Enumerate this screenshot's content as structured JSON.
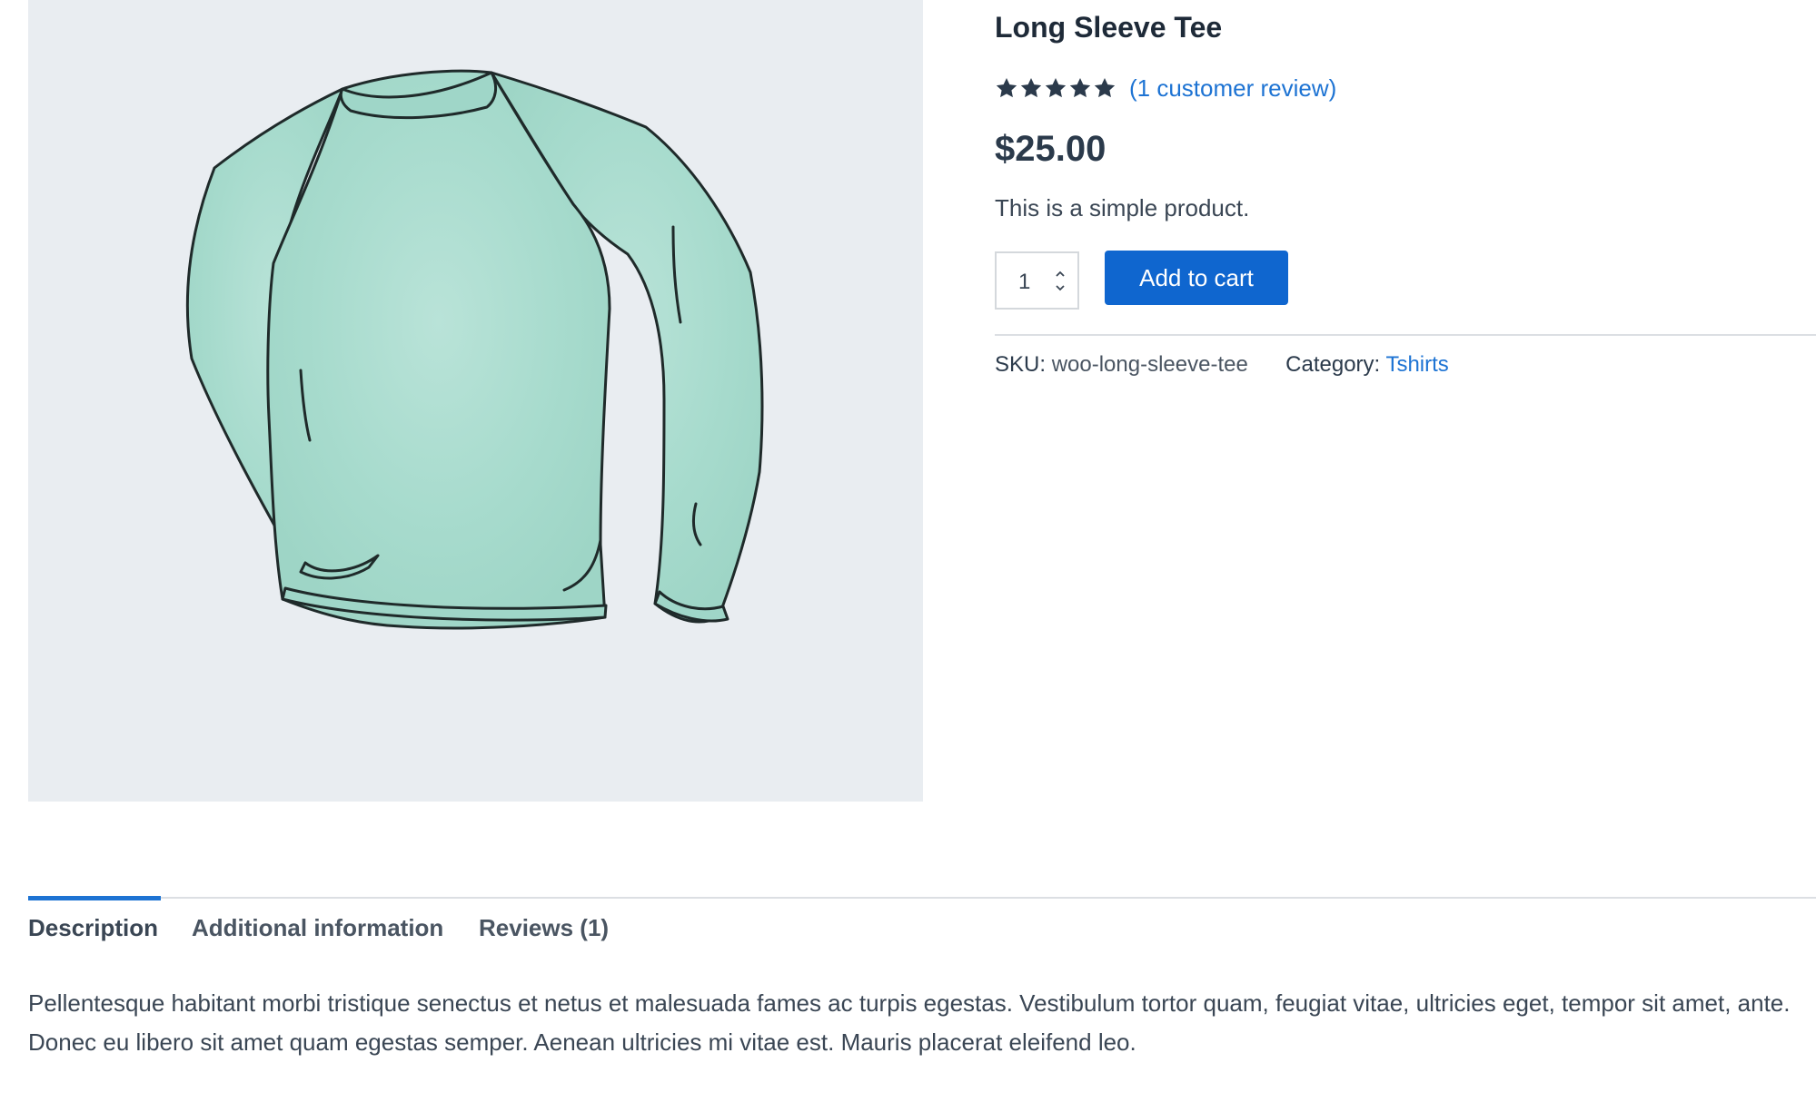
{
  "product": {
    "title": "Long Sleeve Tee",
    "rating": 5,
    "review_link": "(1 customer review)",
    "price": "$25.00",
    "short_description": "This is a simple product.",
    "quantity": "1",
    "add_to_cart_label": "Add to cart",
    "sku_label": "SKU:",
    "sku_value": "woo-long-sleeve-tee",
    "category_label": "Category:",
    "category_value": "Tshirts",
    "image_icon": "long-sleeve-tee-illustration"
  },
  "tabs": [
    {
      "label": "Description",
      "active": true
    },
    {
      "label": "Additional information",
      "active": false
    },
    {
      "label": "Reviews (1)",
      "active": false
    }
  ],
  "description": "Pellentesque habitant morbi tristique senectus et netus et malesuada fames ac turpis egestas. Vestibulum tortor quam, feugiat vitae, ultricies eget, tempor sit amet, ante. Donec eu libero sit amet quam egestas semper. Aenean ultricies mi vitae est. Mauris placerat eleifend leo.",
  "colors": {
    "accent": "#0f66cf",
    "link": "#1d73d3",
    "shirt": "#a9dbcf",
    "image_background": "#e9edf1"
  }
}
